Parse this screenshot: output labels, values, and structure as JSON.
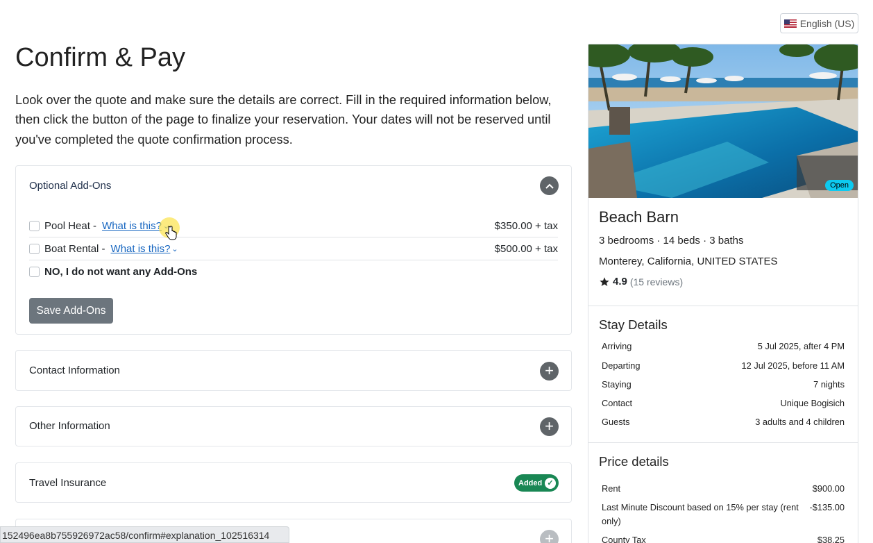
{
  "language": {
    "label": "English (US)"
  },
  "page": {
    "title": "Confirm & Pay",
    "intro": "Look over the quote and make sure the details are correct. Fill in the required information below, then click the button of the page to finalize your reservation. Your dates will not be reserved until you've completed the quote confirmation process."
  },
  "addons": {
    "heading": "Optional Add-Ons",
    "items": [
      {
        "name": "Pool Heat -",
        "link": "What is this?",
        "price": "$350.00 + tax"
      },
      {
        "name": "Boat Rental -",
        "link": "What is this?",
        "price": "$500.00 + tax"
      }
    ],
    "none_label": "NO, I do not want any Add-Ons",
    "save_label": "Save Add-Ons"
  },
  "sections": {
    "contact": "Contact Information",
    "other": "Other Information",
    "insurance": "Travel Insurance",
    "insurance_badge": "Added"
  },
  "status_bar": {
    "url": "152496ea8b755926972ac58/confirm#explanation_102516314"
  },
  "property": {
    "status": "Open",
    "name": "Beach Barn",
    "rooms": "3 bedrooms · 14 beds · 3 baths",
    "location": "Monterey, California, UNITED STATES",
    "rating": "4.9",
    "reviews": "(15 reviews)"
  },
  "stay": {
    "heading": "Stay Details",
    "rows": [
      {
        "label": "Arriving",
        "value": "5 Jul 2025, after 4 PM"
      },
      {
        "label": "Departing",
        "value": "12 Jul 2025, before 11 AM"
      },
      {
        "label": "Staying",
        "value": "7 nights"
      },
      {
        "label": "Contact",
        "value": "Unique Bogisich"
      },
      {
        "label": "Guests",
        "value": "3 adults and 4 children"
      }
    ]
  },
  "price": {
    "heading": "Price details",
    "rows": [
      {
        "label": "Rent",
        "value": "$900.00"
      },
      {
        "label": "Last Minute Discount based on 15% per stay (rent only)",
        "value": "-$135.00"
      },
      {
        "label": "County Tax",
        "value": "$38.25"
      }
    ]
  },
  "colors": {
    "accent_green": "#198754",
    "link_blue": "#1565c0",
    "open_badge": "#0dcaf0",
    "button_gray": "#6c757d"
  }
}
